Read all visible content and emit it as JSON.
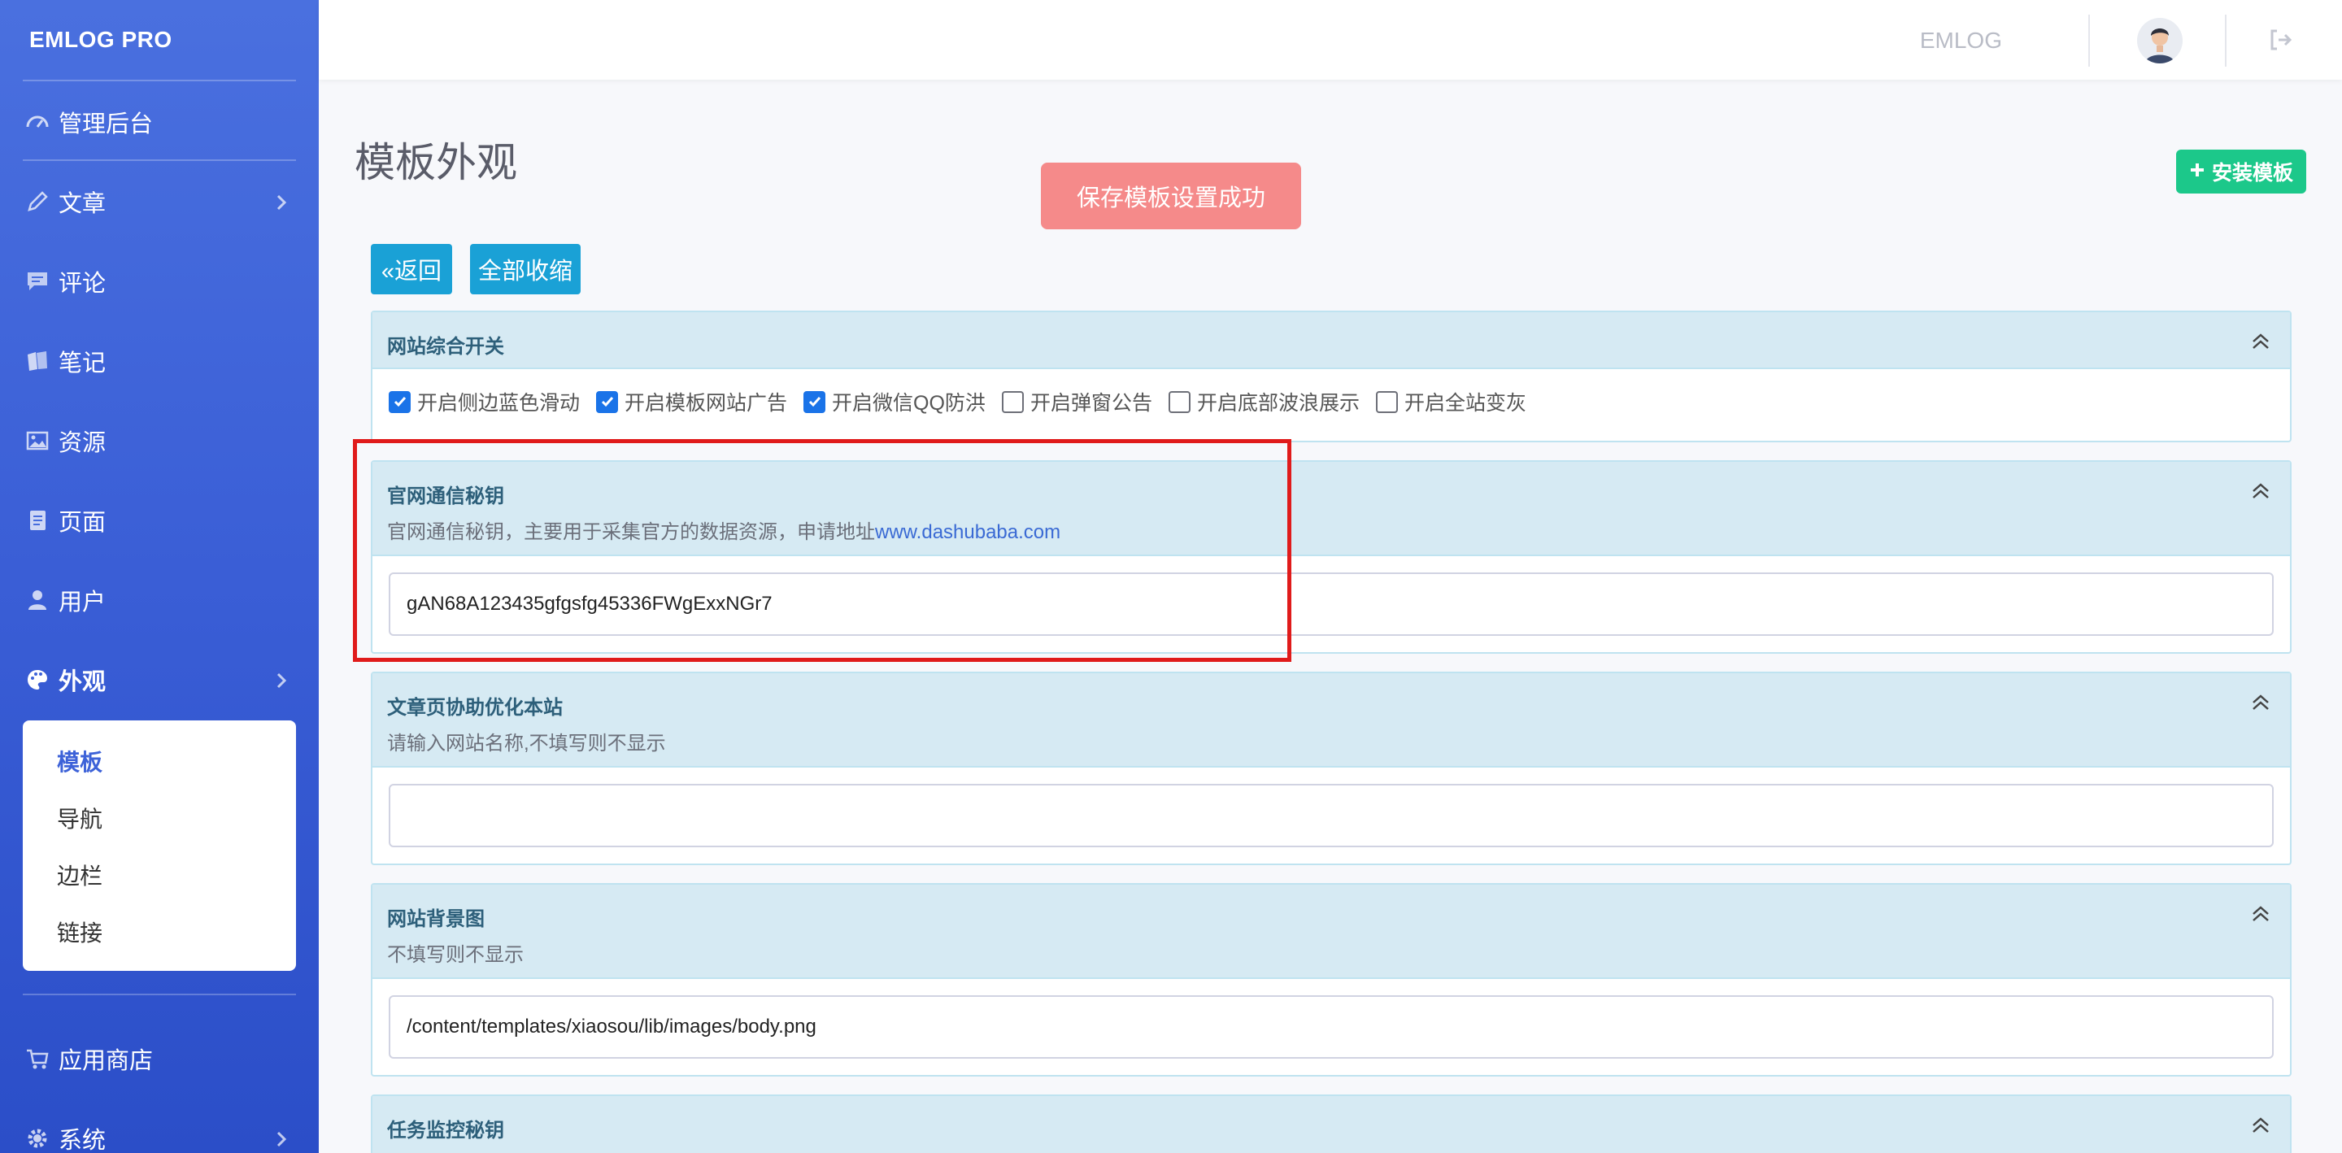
{
  "sidebar": {
    "brand": "EMLOG PRO",
    "items": [
      {
        "label": "管理后台",
        "icon": "dashboard-icon",
        "chevron": false
      },
      {
        "label": "文章",
        "icon": "pencil-icon",
        "chevron": true
      },
      {
        "label": "评论",
        "icon": "comment-icon",
        "chevron": false
      },
      {
        "label": "笔记",
        "icon": "note-icon",
        "chevron": false
      },
      {
        "label": "资源",
        "icon": "image-icon",
        "chevron": false
      },
      {
        "label": "页面",
        "icon": "page-icon",
        "chevron": false
      },
      {
        "label": "用户",
        "icon": "user-icon",
        "chevron": false
      },
      {
        "label": "外观",
        "icon": "palette-icon",
        "chevron": true,
        "active": true
      },
      {
        "label": "应用商店",
        "icon": "cart-icon",
        "chevron": false
      },
      {
        "label": "系统",
        "icon": "gear-icon",
        "chevron": true
      }
    ],
    "submenu": [
      "模板",
      "导航",
      "边栏",
      "链接"
    ],
    "submenu_active": "模板"
  },
  "topbar": {
    "brand": "EMLOG"
  },
  "main": {
    "title": "模板外观",
    "install_button": "安装模板",
    "toast": "保存模板设置成功",
    "back_button": "«返回",
    "collapse_all_button": "全部收缩",
    "panels": [
      {
        "title": "网站综合开关",
        "checkboxes": [
          {
            "label": "开启侧边蓝色滑动",
            "checked": true
          },
          {
            "label": "开启模板网站广告",
            "checked": true
          },
          {
            "label": "开启微信QQ防洪",
            "checked": true
          },
          {
            "label": "开启弹窗公告",
            "checked": false
          },
          {
            "label": "开启底部波浪展示",
            "checked": false
          },
          {
            "label": "开启全站变灰",
            "checked": false
          }
        ]
      },
      {
        "title": "官网通信秘钥",
        "desc": "官网通信秘钥，主要用于采集官方的数据资源，申请地址",
        "desc_link": "www.dashubaba.com",
        "value": "gAN68A123435gfgsfg45336FWgExxNGr7"
      },
      {
        "title": "文章页协助优化本站",
        "desc": "请输入网站名称,不填写则不显示",
        "value": ""
      },
      {
        "title": "网站背景图",
        "desc": "不填写则不显示",
        "value": "/content/templates/xiaosou/lib/images/body.png"
      },
      {
        "title": "任务监控秘钥"
      }
    ]
  },
  "colors": {
    "sidebar_top": "#4a70df",
    "sidebar_bottom": "#2b4ec8",
    "accent_green": "#1cc88a",
    "toast_red": "#f58a8a",
    "button_blue": "#1aa1d6",
    "panel_head": "#d6eaf3",
    "highlight_red": "#e01b1b"
  }
}
